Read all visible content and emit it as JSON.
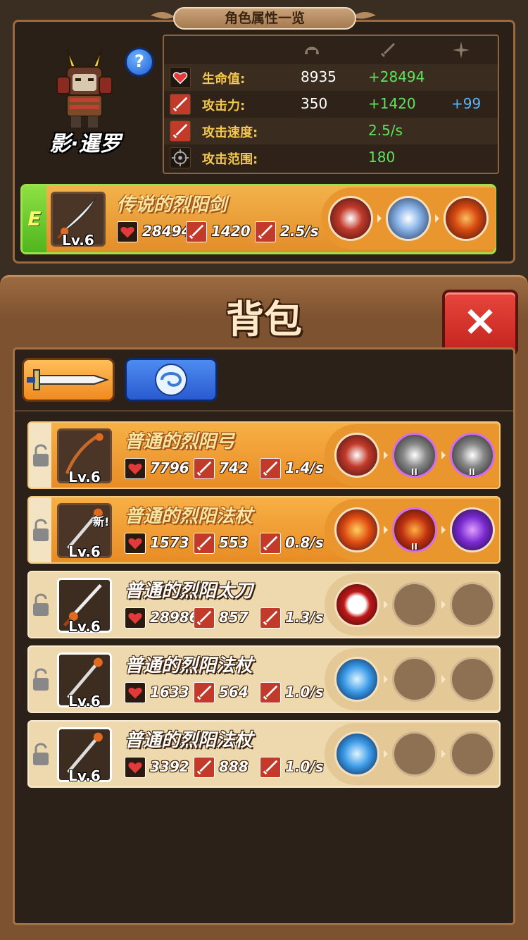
{
  "header": {
    "title": "角色属性一览"
  },
  "character": {
    "name": "影·暹罗",
    "help_label": "?"
  },
  "stats": {
    "head_icons": [
      "helmet-icon",
      "sword-icon",
      "sparkle-icon"
    ],
    "rows": [
      {
        "icon": "heart-icon",
        "label": "生命值:",
        "base": "8935",
        "bonus": "+28494",
        "extra": ""
      },
      {
        "icon": "sword-icon",
        "label": "攻击力:",
        "base": "350",
        "bonus": "+1420",
        "extra": "+99"
      },
      {
        "icon": "sword-icon",
        "label": "攻击速度:",
        "base": "",
        "bonus": "2.5/s",
        "extra": ""
      },
      {
        "icon": "target-icon",
        "label": "攻击范围:",
        "base": "",
        "bonus": "180",
        "extra": ""
      }
    ]
  },
  "equipped": {
    "tag": "E",
    "name": "传说的烈阳剑",
    "level": "Lv.6",
    "hp": "28494",
    "atk": "1420",
    "speed": "2.5/s",
    "skills": [
      "arrow-dash-icon",
      "lightning-icon",
      "fire-triple-icon"
    ]
  },
  "bag": {
    "title": "背包",
    "close_label": "×",
    "tabs": [
      "weapon-tab",
      "skill-tab"
    ],
    "items": [
      {
        "name": "普通的烈阳弓",
        "level": "Lv.6",
        "hp": "7796",
        "atk": "742",
        "speed": "1.4/s",
        "rarity": "orange",
        "new": "",
        "skills": [
          "arrow-icon",
          "spike-ball-icon",
          "triple-spike-icon"
        ]
      },
      {
        "name": "普通的烈阳法杖",
        "level": "Lv.6",
        "hp": "1573",
        "atk": "553",
        "speed": "0.8/s",
        "rarity": "orange",
        "new": "新!",
        "skills": [
          "fireball-icon",
          "flame-pillar-icon",
          "purple-orb-icon"
        ]
      },
      {
        "name": "普通的烈阳太刀",
        "level": "Lv.6",
        "hp": "28986",
        "atk": "857",
        "speed": "1.3/s",
        "rarity": "plain",
        "new": "",
        "skills": [
          "crescent-icon",
          "empty-slot-icon",
          "empty-slot-icon"
        ]
      },
      {
        "name": "普通的烈阳法杖",
        "level": "Lv.6",
        "hp": "1633",
        "atk": "564",
        "speed": "1.0/s",
        "rarity": "plain",
        "new": "",
        "skills": [
          "ice-ball-icon",
          "empty-slot-icon",
          "empty-slot-icon"
        ]
      },
      {
        "name": "普通的烈阳法杖",
        "level": "Lv.6",
        "hp": "3392",
        "atk": "888",
        "speed": "1.0/s",
        "rarity": "plain",
        "new": "",
        "skills": [
          "ice-ball-icon",
          "empty-slot-icon",
          "empty-slot-icon"
        ]
      }
    ]
  },
  "colors": {
    "stat_label": "#f4c84c",
    "bonus": "#5fe35a",
    "extra": "#58b6ff",
    "orange_item": "#f7b045",
    "plain_item": "#eed8ad"
  }
}
